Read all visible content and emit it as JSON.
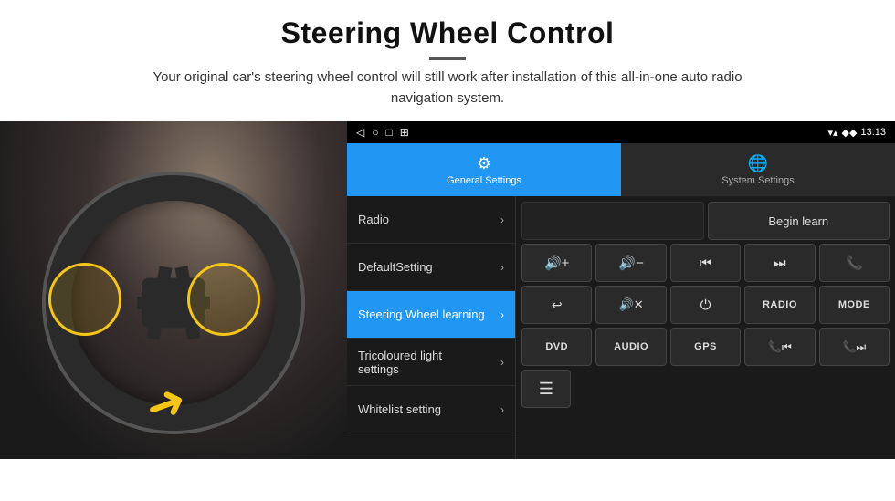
{
  "header": {
    "title": "Steering Wheel Control",
    "subtitle": "Your original car's steering wheel control will still work after installation of this all-in-one auto radio navigation system."
  },
  "status_bar": {
    "back_icon": "◁",
    "home_icon": "○",
    "recents_icon": "□",
    "screenshot_icon": "⊞",
    "wifi_icon": "▼",
    "signal_icon": "♦",
    "time": "13:13"
  },
  "tabs": [
    {
      "id": "general",
      "label": "General Settings",
      "icon": "⚙",
      "active": true
    },
    {
      "id": "system",
      "label": "System Settings",
      "icon": "🌐",
      "active": false
    }
  ],
  "menu_items": [
    {
      "label": "Radio",
      "active": false
    },
    {
      "label": "DefaultSetting",
      "active": false
    },
    {
      "label": "Steering Wheel learning",
      "active": true
    },
    {
      "label": "Tricoloured light settings",
      "active": false
    },
    {
      "label": "Whitelist setting",
      "active": false
    }
  ],
  "controls": {
    "begin_learn": "Begin learn",
    "row1": [
      {
        "icon": "🔊+",
        "label": "vol_up"
      },
      {
        "icon": "🔊-",
        "label": "vol_down"
      },
      {
        "icon": "⏮",
        "label": "prev"
      },
      {
        "icon": "⏭",
        "label": "next"
      },
      {
        "icon": "📞",
        "label": "call"
      }
    ],
    "row2": [
      {
        "icon": "↩",
        "label": "back"
      },
      {
        "icon": "🔇×",
        "label": "mute"
      },
      {
        "icon": "⏻",
        "label": "power"
      },
      {
        "text": "RADIO",
        "label": "radio_btn"
      },
      {
        "text": "MODE",
        "label": "mode_btn"
      }
    ],
    "row3": [
      {
        "text": "DVD",
        "label": "dvd_btn"
      },
      {
        "text": "AUDIO",
        "label": "audio_btn"
      },
      {
        "text": "GPS",
        "label": "gps_btn"
      },
      {
        "icon": "📞⏮",
        "label": "call_prev"
      },
      {
        "icon": "📞⏭",
        "label": "call_next"
      }
    ],
    "row4": [
      {
        "icon": "≡",
        "label": "menu_icon"
      }
    ]
  }
}
